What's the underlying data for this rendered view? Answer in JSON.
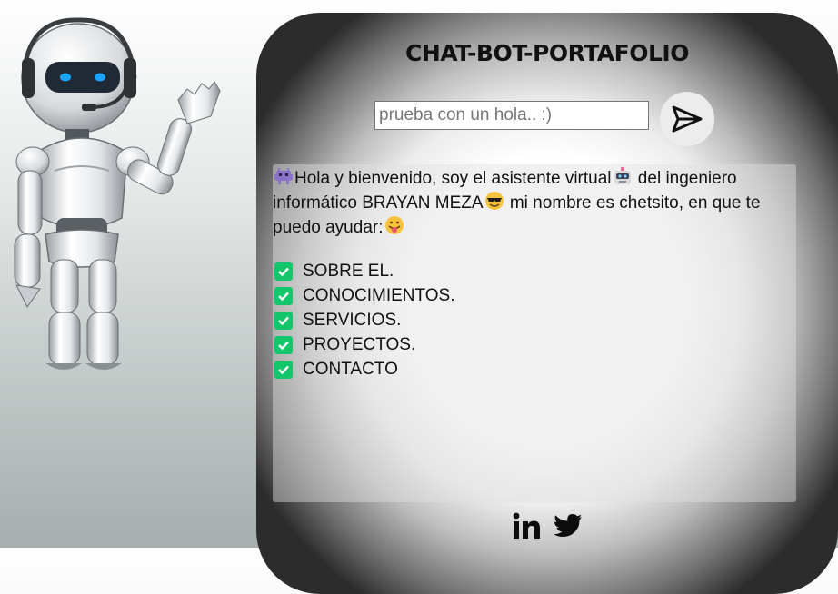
{
  "chat": {
    "title": "CHAT-BOT-PORTAFOLIO",
    "input_placeholder": "prueba con un hola.. :)",
    "input_value": "",
    "message": {
      "part1": "Hola y bienvenido, soy el asistente virtual",
      "part2": " del ingeniero informático BRAYAN MEZA",
      "part3": " mi nombre es chetsito, en que te puedo ayudar:"
    },
    "options": [
      "SOBRE EL.",
      "CONOCIMIENTOS.",
      "SERVICIOS.",
      "PROYECTOS.",
      "CONTACTO"
    ]
  },
  "icons": {
    "send": "paper-plane-icon",
    "message_emojis": [
      "alien-monster-icon",
      "robot-face-icon",
      "smiling-sunglasses-icon",
      "tongue-out-icon"
    ],
    "option_marker": "check-box-icon",
    "social": [
      "linkedin-icon",
      "twitter-icon"
    ]
  },
  "colors": {
    "check_green": "#13c56b",
    "title_text": "#111111",
    "panel_dark": "#2c2c2c"
  }
}
